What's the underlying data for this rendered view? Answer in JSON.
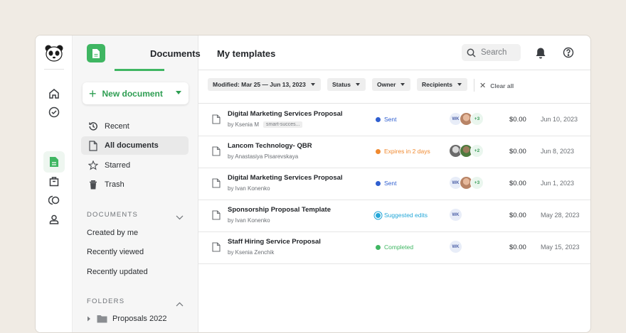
{
  "rail": {
    "icons": [
      "panda-logo-icon",
      "home-icon",
      "check-circle-icon",
      "document-icon",
      "shopping-bag-icon",
      "contacts-icon",
      "user-icon"
    ]
  },
  "sidebar": {
    "new_document_label": "New document",
    "nav": [
      {
        "label": "Recent",
        "icon": "history-icon"
      },
      {
        "label": "All documents",
        "icon": "document-icon",
        "active": true
      },
      {
        "label": "Starred",
        "icon": "star-icon"
      },
      {
        "label": "Trash",
        "icon": "trash-icon"
      }
    ],
    "documents_heading": "DOCUMENTS",
    "documents_items": [
      "Created by me",
      "Recently viewed",
      "Recently updated"
    ],
    "folders_heading": "FOLDERS",
    "folders_items": [
      "Proposals 2022"
    ]
  },
  "header": {
    "tabs": [
      "Documents",
      "My templates"
    ],
    "active_tab": "Documents",
    "search_placeholder": "Search"
  },
  "filters": {
    "chips": [
      "Modified: Mar 25 — Jun 13, 2023",
      "Status",
      "Owner",
      "Recipients"
    ],
    "clear_all": "Clear all"
  },
  "colors": {
    "accent": "#3fb662",
    "sent": "#2f5fd0",
    "expires": "#f0892f",
    "suggested": "#24a7d8",
    "completed": "#3fb662"
  },
  "documents": [
    {
      "title": "Digital Marketing Services Proposal",
      "byline": "by Ksenia M",
      "tag": "smart-succes...",
      "status": "Sent",
      "status_color": "#2f5fd0",
      "recipients_initials": "WK",
      "extra_avatars": 1,
      "more": "+3",
      "amount": "$0.00",
      "date": "Jun 10, 2023"
    },
    {
      "title": "Lancom Technology- QBR",
      "byline": "by Anastasiya Pisarevskaya",
      "tag": "",
      "status": "Expires in 2 days",
      "status_color": "#f0892f",
      "recipients_initials": "",
      "extra_avatars": 2,
      "more": "+2",
      "amount": "$0.00",
      "date": "Jun 8, 2023"
    },
    {
      "title": "Digital Marketing Services Proposal",
      "byline": "by Ivan Konenko",
      "tag": "",
      "status": "Sent",
      "status_color": "#2f5fd0",
      "recipients_initials": "WK",
      "extra_avatars": 1,
      "more": "+3",
      "amount": "$0.00",
      "date": "Jun 1, 2023"
    },
    {
      "title": "Sponsorship Proposal Template",
      "byline": "by Ivan Konenko",
      "tag": "",
      "status": "Suggested edits",
      "status_color": "#24a7d8",
      "recipients_initials": "WK",
      "extra_avatars": 0,
      "more": "",
      "amount": "$0.00",
      "date": "May 28, 2023"
    },
    {
      "title": "Staff Hiring Service Proposal",
      "byline": "by Ksenia Zenchik",
      "tag": "",
      "status": "Completed",
      "status_color": "#3fb662",
      "recipients_initials": "WK",
      "extra_avatars": 0,
      "more": "",
      "amount": "$0.00",
      "date": "May 15, 2023"
    }
  ]
}
